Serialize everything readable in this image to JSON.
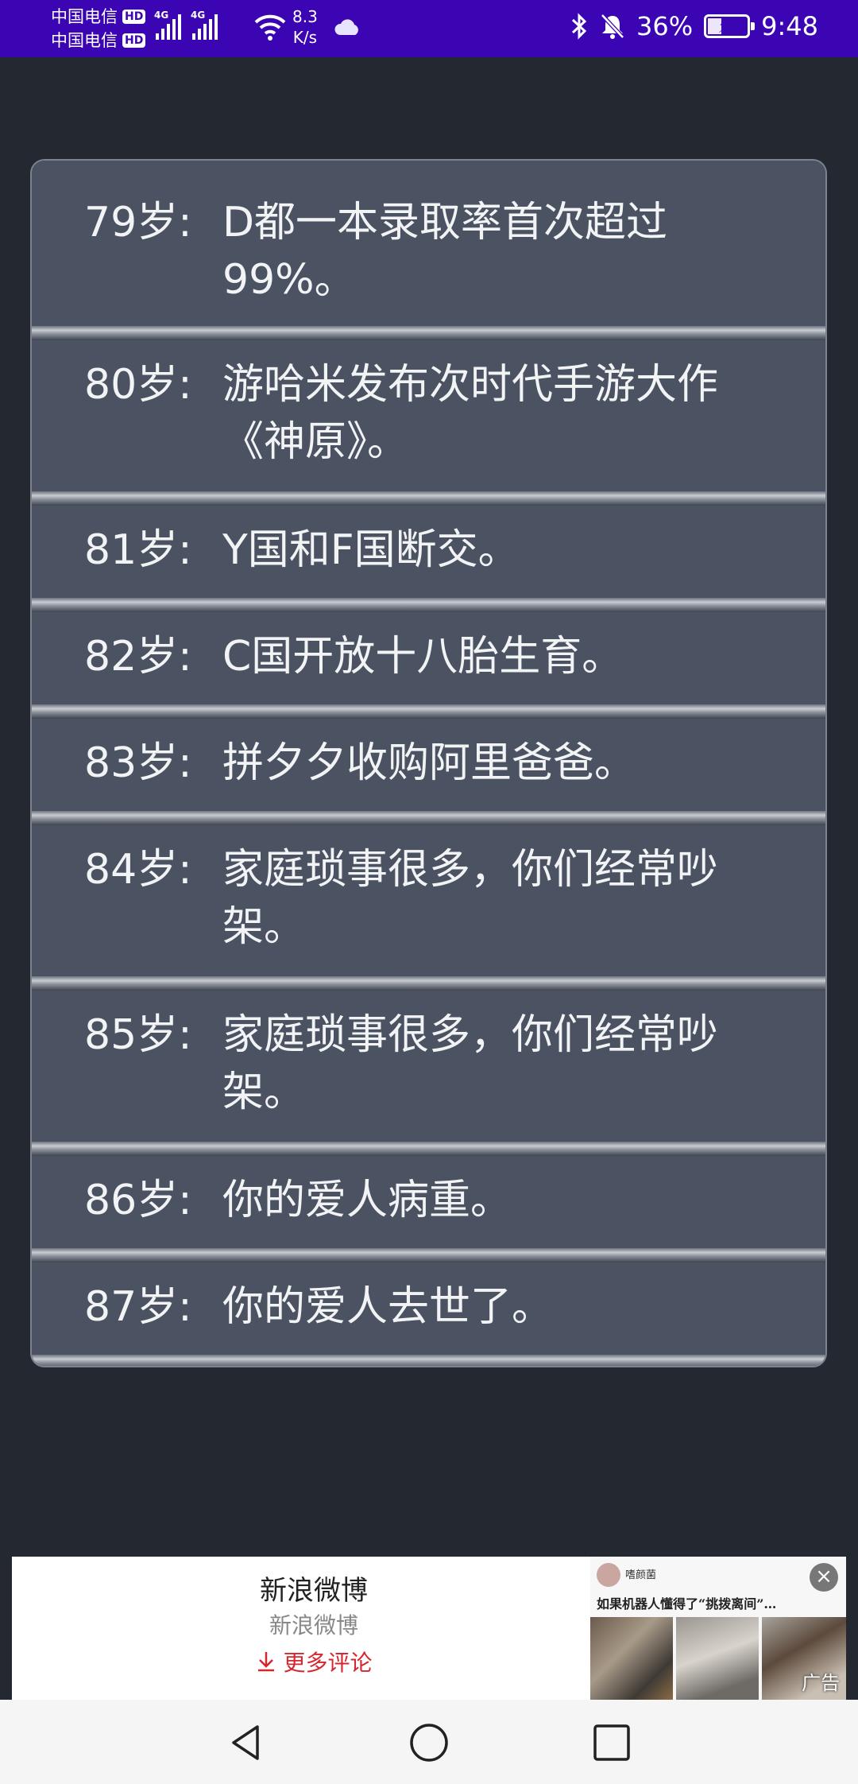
{
  "status_bar": {
    "carrier1": "中国电信",
    "carrier2": "中国电信",
    "hd": "HD",
    "net_type": "4G",
    "speed_value": "8.3",
    "speed_unit": "K/s",
    "battery_percent": "36%",
    "battery_level": 0.36,
    "time": "9:48"
  },
  "events": [
    {
      "age": "79岁:",
      "text": "D都一本录取率首次超过99%。"
    },
    {
      "age": "80岁:",
      "text": "游哈米发布次时代手游大作《神原》。"
    },
    {
      "age": "81岁:",
      "text": "Y国和F国断交。"
    },
    {
      "age": "82岁:",
      "text": "C国开放十八胎生育。"
    },
    {
      "age": "83岁:",
      "text": "拼夕夕收购阿里爸爸。"
    },
    {
      "age": "84岁:",
      "text": "家庭琐事很多，你们经常吵架。"
    },
    {
      "age": "85岁:",
      "text": "家庭琐事很多，你们经常吵架。"
    },
    {
      "age": "86岁:",
      "text": "你的爱人病重。"
    },
    {
      "age": "87岁:",
      "text": "你的爱人去世了。"
    }
  ],
  "ad": {
    "title": "新浪微博",
    "subtitle": "新浪微博",
    "more_comments": "更多评论",
    "author": "嗜颜菌",
    "caption": "如果机器人懂得了“挑拨离间”…",
    "label": "广告"
  }
}
